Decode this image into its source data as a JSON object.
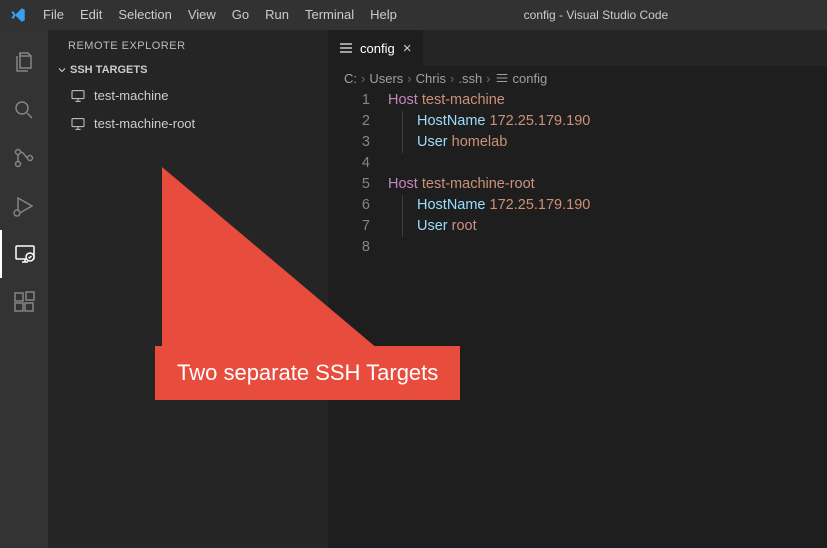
{
  "titlebar": {
    "title": "config - Visual Studio Code",
    "menu": [
      "File",
      "Edit",
      "Selection",
      "View",
      "Go",
      "Run",
      "Terminal",
      "Help"
    ]
  },
  "sidebar": {
    "title": "REMOTE EXPLORER",
    "section": "SSH TARGETS",
    "items": [
      {
        "label": "test-machine"
      },
      {
        "label": "test-machine-root"
      }
    ]
  },
  "editor": {
    "tab_label": "config",
    "breadcrumbs": [
      "C:",
      "Users",
      "Chris",
      ".ssh",
      "config"
    ],
    "lines": [
      {
        "n": 1,
        "type": "host",
        "kw": "Host",
        "val": "test-machine"
      },
      {
        "n": 2,
        "type": "kv",
        "key": "HostName",
        "val": "172.25.179.190"
      },
      {
        "n": 3,
        "type": "kv",
        "key": "User",
        "val": "homelab"
      },
      {
        "n": 4,
        "type": "blank"
      },
      {
        "n": 5,
        "type": "host",
        "kw": "Host",
        "val": "test-machine-root"
      },
      {
        "n": 6,
        "type": "kv",
        "key": "HostName",
        "val": "172.25.179.190"
      },
      {
        "n": 7,
        "type": "kv",
        "key": "User",
        "val": "root"
      },
      {
        "n": 8,
        "type": "blank"
      }
    ]
  },
  "callout": {
    "text": "Two separate SSH Targets"
  }
}
